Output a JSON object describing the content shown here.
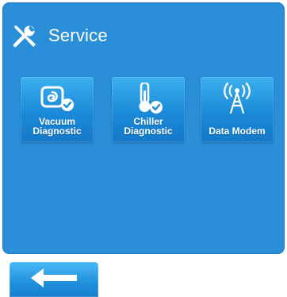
{
  "header": {
    "title": "Service",
    "icon": "tools-icon"
  },
  "tiles": [
    {
      "label": "Vacuum\nDiagnostic",
      "icon": "vacuum-swirl-check-icon"
    },
    {
      "label": "Chiller\nDiagnostic",
      "icon": "thermometer-check-icon"
    },
    {
      "label": "Data Modem",
      "icon": "antenna-tower-icon"
    }
  ],
  "footer": {
    "back_icon": "left-arrow-icon"
  },
  "colors": {
    "panel": "#2a8fd8",
    "tile": "#1b8ad8",
    "text": "#ffffff"
  }
}
